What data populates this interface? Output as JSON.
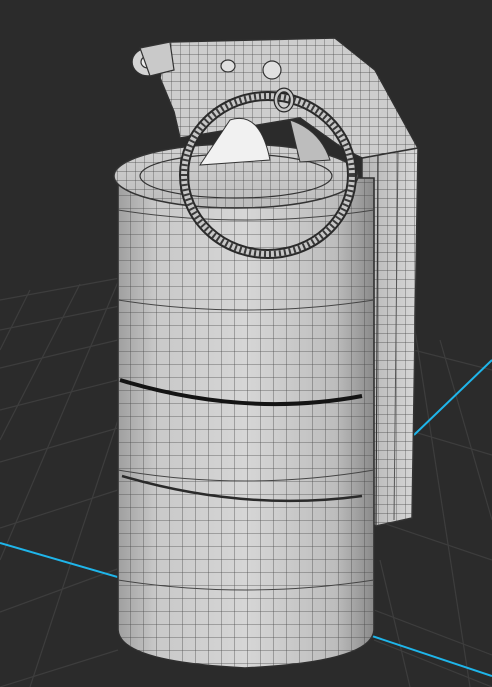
{
  "viewport": {
    "background": "#2b2b2b",
    "grid_color": "#3a3a3a",
    "axis_color": "#20b2e6"
  },
  "model": {
    "name": "grenade-wireframe-mesh",
    "surface_color": "#c8c8c8",
    "wire_color": "#3c3c3c",
    "parts": [
      "canister-body",
      "canister-top-cap",
      "center-groove",
      "bottom-seam",
      "spoon-lever",
      "pull-ring",
      "pin-hinge"
    ]
  }
}
